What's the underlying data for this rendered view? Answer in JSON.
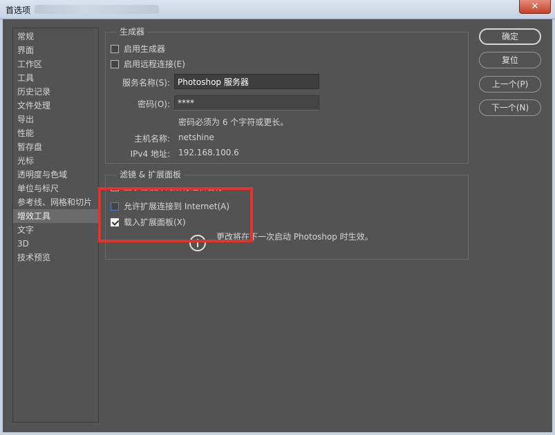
{
  "window": {
    "title": "首选项",
    "close_glyph": "✕"
  },
  "sidebar": {
    "items": [
      "常规",
      "界面",
      "工作区",
      "工具",
      "历史记录",
      "文件处理",
      "导出",
      "性能",
      "暂存盘",
      "光标",
      "透明度与色域",
      "单位与标尺",
      "参考线、网格和切片",
      "增效工具",
      "文字",
      "3D",
      "技术预览"
    ],
    "selected_index": 13
  },
  "generator": {
    "legend": "生成器",
    "enable_generator": {
      "label": "启用生成器",
      "checked": false
    },
    "enable_remote": {
      "label": "启用远程连接(E)",
      "checked": false
    },
    "service_name_label": "服务名称(S):",
    "service_name_value": "Photoshop 服务器",
    "password_label": "密码(O):",
    "password_value": "****",
    "password_hint": "密码必须为 6 个字符或更长。",
    "hostname_label": "主机名称:",
    "hostname_value": "netshine",
    "ipv4_label": "IPv4 地址:",
    "ipv4_value": "192.168.100.6"
  },
  "filters": {
    "legend": "滤镜 & 扩展面板",
    "show_all_filters": {
      "label": "显示滤镜库的所有组和名称",
      "checked": false
    },
    "allow_internet": {
      "label": "允许扩展连接到 Internet(A)",
      "checked": false
    },
    "load_panels": {
      "label": "载入扩展面板(X)",
      "checked": true
    },
    "restart_note": "更改将在下一次启动 Photoshop 时生效。"
  },
  "buttons": {
    "ok": "确定",
    "reset": "复位",
    "prev": "上一个(P)",
    "next": "下一个(N)"
  },
  "colors": {
    "panel_bg": "#535353",
    "highlight": "#e8312c",
    "selected_item": "#6b6b6b"
  }
}
